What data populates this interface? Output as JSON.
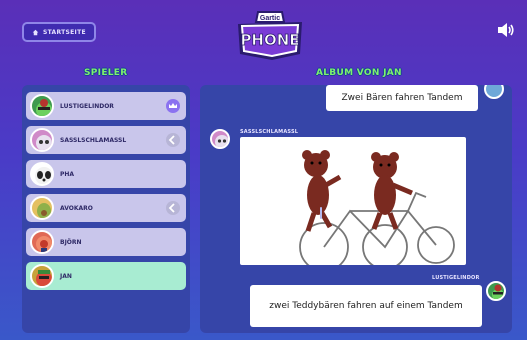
{
  "header": {
    "home_label": "STARTSEITE",
    "logo_top": "Gartic",
    "logo_main": "PHONE"
  },
  "players": {
    "title": "SPIELER",
    "items": [
      {
        "name": "LUSTIGELINDOR",
        "badge": "crown-icon"
      },
      {
        "name": "SASSLSCHLAMASSL",
        "badge": "arrow-icon"
      },
      {
        "name": "PHA",
        "badge": ""
      },
      {
        "name": "AVOKARO",
        "badge": "arrow-icon"
      },
      {
        "name": "BJÖRN",
        "badge": ""
      },
      {
        "name": "JAN",
        "badge": ""
      }
    ]
  },
  "album": {
    "title": "ALBUM VON JAN",
    "messages": [
      {
        "author": "",
        "type": "text",
        "text": "Zwei Bären fahren Tandem"
      },
      {
        "author": "SASSLSCHLAMASSL",
        "type": "drawing"
      },
      {
        "author": "LUSTIGELINDOR",
        "type": "text",
        "text": "zwei Teddybären fahren auf einem Tandem"
      }
    ]
  },
  "colors": {
    "accent_green": "#7cf36d",
    "panel": "#3645a8",
    "active_row": "#a8ecd2",
    "row": "#c9c6eb",
    "badge": "#8b72f0"
  }
}
